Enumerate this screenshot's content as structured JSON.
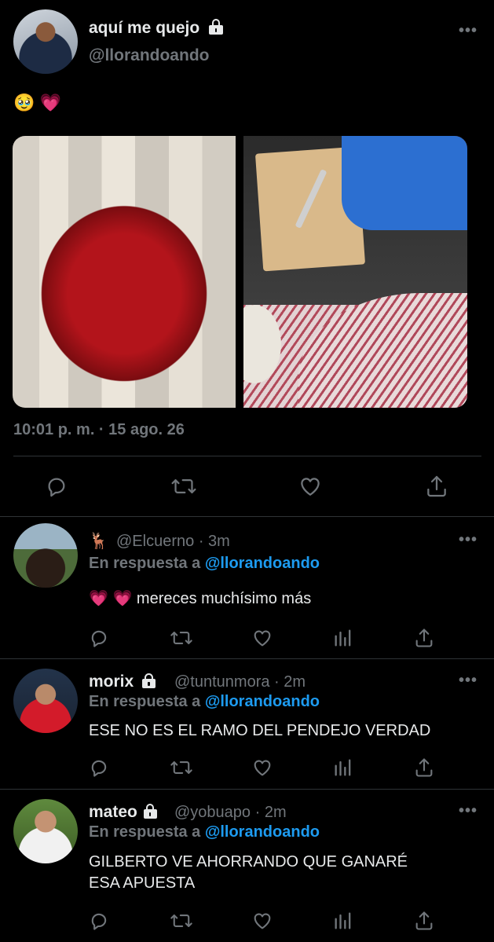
{
  "main_tweet": {
    "display_name": "aquí me quejo",
    "handle": "@llorandoando",
    "text_emojis": "🥹 💗",
    "timestamp": "10:01 p. m. · 15 ago. 26",
    "more": "•••",
    "photos": [
      {
        "subject": "bouquet of red roses"
      },
      {
        "subject": "kitchen counter with cutting board and knife"
      }
    ],
    "actions": [
      "reply-icon",
      "retweet-icon",
      "like-icon",
      "share-icon"
    ]
  },
  "replies": [
    {
      "emoji": "🦌",
      "display_name": "",
      "handle": "@Elcuerno",
      "time": "· 3m",
      "reply_prefix": "En respuesta a ",
      "reply_mention": "@llorandoando",
      "text": "💗 💗 mereces muchísimo más",
      "more": "•••"
    },
    {
      "display_name": "morix",
      "handle": "@tuntunmora",
      "time": "· 2m",
      "reply_prefix": "En respuesta a ",
      "reply_mention": "@llorandoando",
      "text": "ESE NO ES EL RAMO DEL PENDEJO VERDAD",
      "more": "•••"
    },
    {
      "display_name": "mateo",
      "handle": "@yobuapo",
      "time": "· 2m",
      "reply_prefix": "En respuesta a ",
      "reply_mention": "@llorandoando",
      "text_line1": "GILBERTO VE AHORRANDO QUE GANARÉ",
      "text_line2": "ESA APUESTA",
      "more": "•••"
    }
  ],
  "colors": {
    "background": "#000000",
    "text": "#e7e9ea",
    "muted": "#71767b",
    "link": "#1d9bf0",
    "divider": "#2f3336"
  }
}
